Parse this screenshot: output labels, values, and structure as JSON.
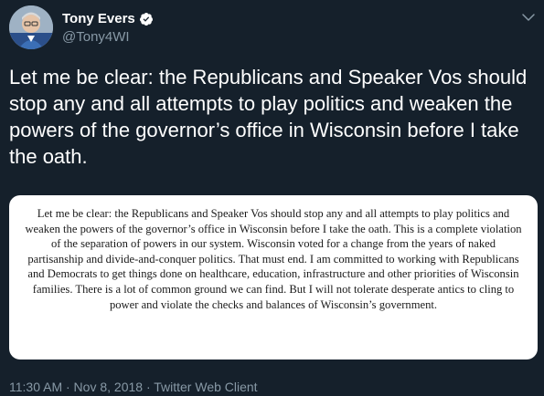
{
  "author": {
    "name": "Tony Evers",
    "handle": "@Tony4WI",
    "verified": true
  },
  "tweet": {
    "text": "Let me be clear: the Republicans and Speaker Vos should stop any and all attempts to play politics and weaken the powers of the governor’s office in Wisconsin before I take the oath."
  },
  "statement_image": {
    "text": "Let me be clear: the Republicans and Speaker Vos should stop any and all attempts to play politics and weaken the powers of the governor’s office in Wisconsin before I take the oath.  This is a complete violation of the separation of powers in our system.  Wisconsin voted for a change from the years of naked partisanship and divide-and-conquer politics. That must end.  I am committed to working with Republicans and Democrats to get things done on healthcare, education, infrastructure and other priorities of Wisconsin families.  There is a lot of common ground we can find. But I will not tolerate desperate antics to cling to power and violate the checks and balances of Wisconsin’s government."
  },
  "meta": {
    "timestamp": "11:30 AM · Nov 8, 2018 · Twitter Web Client"
  },
  "icons": {
    "verified": "verified-badge-icon",
    "chevron": "chevron-down-icon"
  },
  "colors": {
    "background": "#15202b",
    "secondary_text": "#8899a6",
    "accent": "#1da1f2"
  }
}
